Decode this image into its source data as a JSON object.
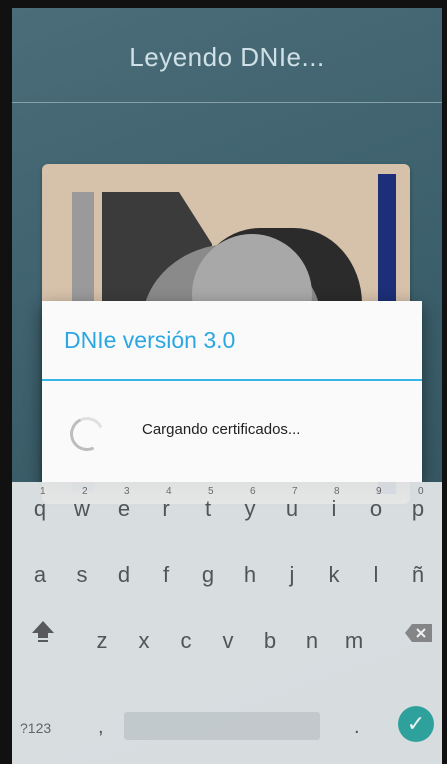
{
  "header": {
    "title": "Leyendo DNIe..."
  },
  "dialog": {
    "title": "DNIe versión 3.0",
    "message": "Cargando certificados..."
  },
  "keyboard": {
    "row1": [
      {
        "k": "q",
        "h": "1"
      },
      {
        "k": "w",
        "h": "2"
      },
      {
        "k": "e",
        "h": "3"
      },
      {
        "k": "r",
        "h": "4"
      },
      {
        "k": "t",
        "h": "5"
      },
      {
        "k": "y",
        "h": "6"
      },
      {
        "k": "u",
        "h": "7"
      },
      {
        "k": "i",
        "h": "8"
      },
      {
        "k": "o",
        "h": "9"
      },
      {
        "k": "p",
        "h": "0"
      }
    ],
    "row2": [
      "a",
      "s",
      "d",
      "f",
      "g",
      "h",
      "j",
      "k",
      "l",
      "ñ"
    ],
    "row3": [
      "z",
      "x",
      "c",
      "v",
      "b",
      "n",
      "m"
    ],
    "symbols_label": "?123",
    "comma_label": ",",
    "period_label": "."
  }
}
